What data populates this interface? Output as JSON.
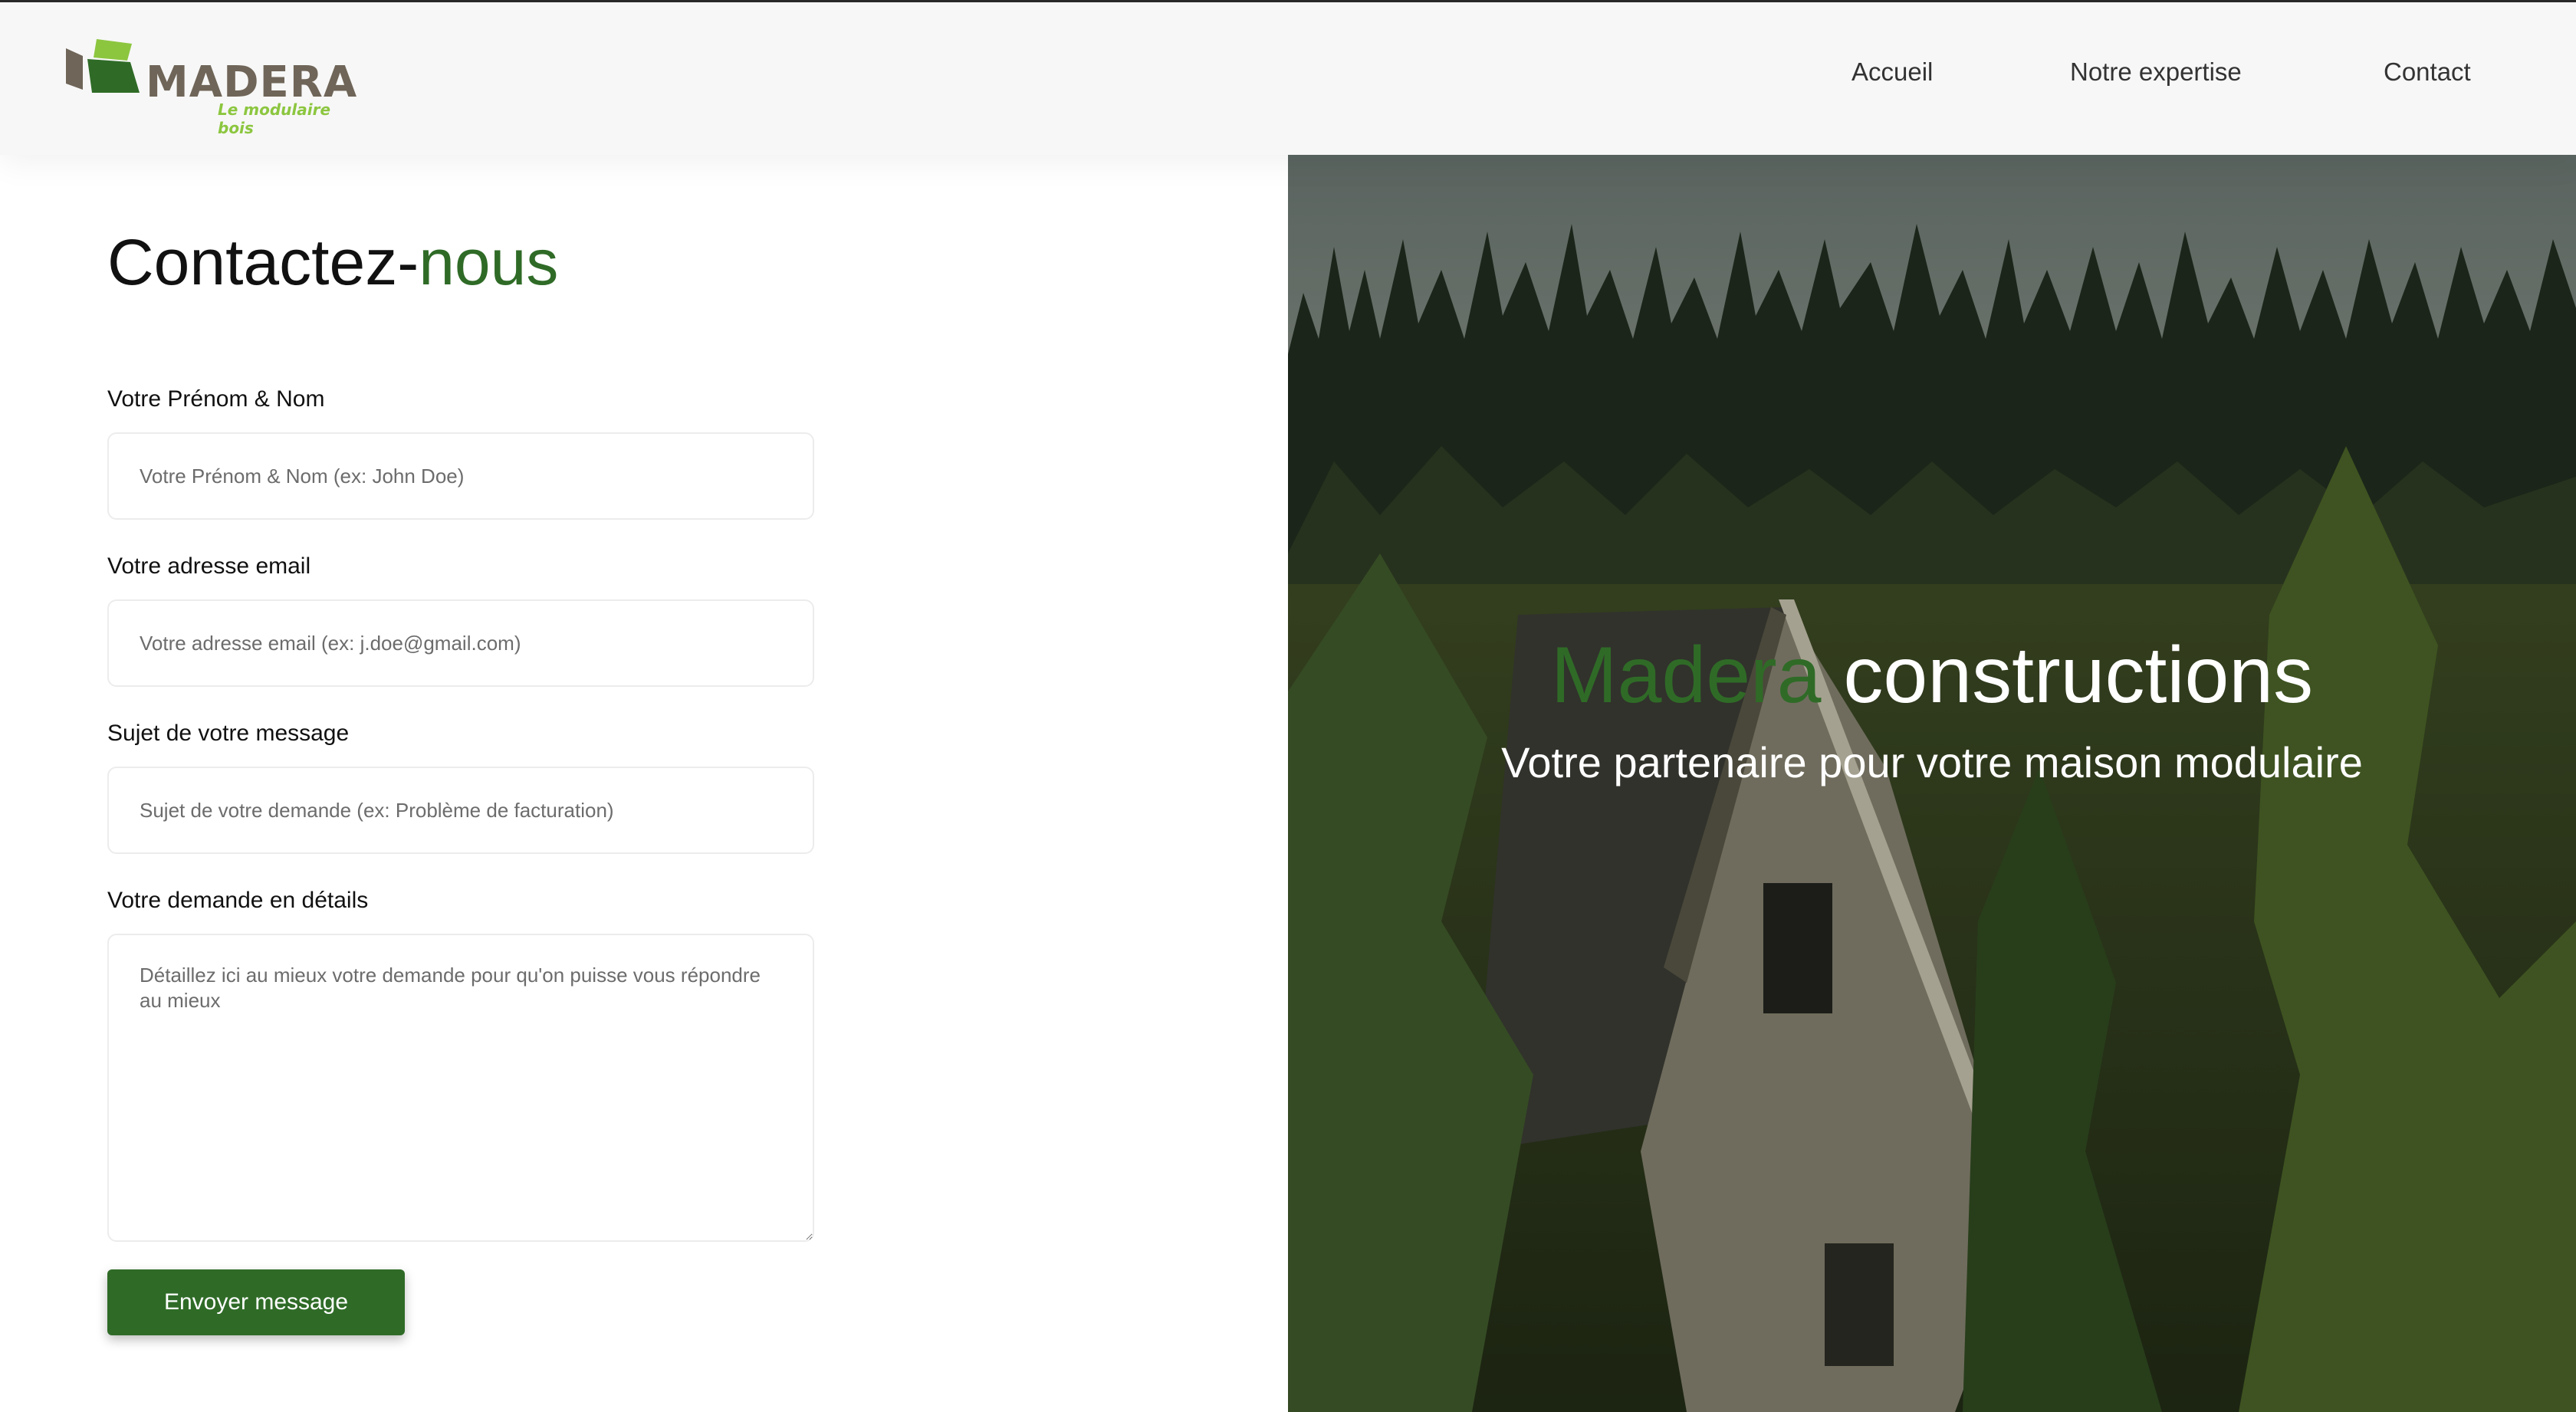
{
  "brand": {
    "name": "MADERA",
    "tagline": "Le modulaire bois"
  },
  "nav": {
    "accueil": "Accueil",
    "expertise": "Notre expertise",
    "contact": "Contact"
  },
  "page": {
    "title_main": "Contactez-",
    "title_accent": "nous"
  },
  "form": {
    "name_label": "Votre Prénom & Nom",
    "name_placeholder": "Votre Prénom & Nom (ex: John Doe)",
    "email_label": "Votre adresse email",
    "email_placeholder": "Votre adresse email (ex: j.doe@gmail.com)",
    "subject_label": "Sujet de votre message",
    "subject_placeholder": "Sujet de votre demande (ex: Problème de facturation)",
    "details_label": "Votre demande en détails",
    "details_placeholder": "Détaillez ici au mieux votre demande pour qu'on puisse vous répondre au mieux",
    "submit": "Envoyer message"
  },
  "hero": {
    "title_accent": "Madera",
    "title_rest": " constructions",
    "subtitle": "Votre partenaire pour votre maison modulaire"
  },
  "colors": {
    "accent": "#2f6b27",
    "logo_green": "#8cc63f",
    "logo_brown": "#6f6558"
  }
}
